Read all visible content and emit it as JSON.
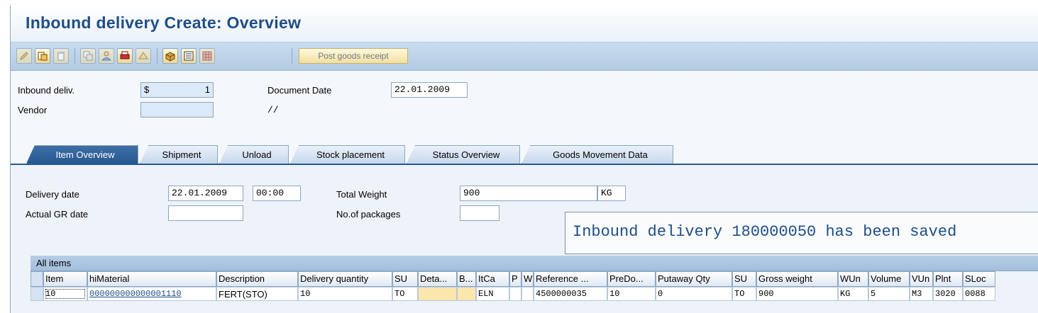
{
  "window": {
    "title": "Inbound delivery  Create: Overview"
  },
  "toolbar": {
    "icons": [
      "edit-pencil-icon",
      "display-change-icon",
      "delete-icon",
      "copy-icon",
      "person-icon",
      "print-icon",
      "ticket-icon",
      "package-icon",
      "structure-icon",
      "grid-icon"
    ],
    "post_goods_receipt_label": "Post goods receipt"
  },
  "header": {
    "inbound_deliv_label": "Inbound deliv.",
    "inbound_deliv_prefix": "$",
    "inbound_deliv_value": "1",
    "document_date_label": "Document Date",
    "document_date_value": "22.01.2009",
    "vendor_label": "Vendor",
    "vendor_value": "",
    "vendor_name": "//"
  },
  "tabs": [
    {
      "label": "Item Overview",
      "active": true
    },
    {
      "label": "Shipment",
      "active": false
    },
    {
      "label": "Unload",
      "active": false
    },
    {
      "label": "Stock placement",
      "active": false
    },
    {
      "label": "Status Overview",
      "active": false
    },
    {
      "label": "Goods Movement Data",
      "active": false
    }
  ],
  "item_overview": {
    "delivery_date_label": "Delivery date",
    "delivery_date_value": "22.01.2009",
    "delivery_time_value": "00:00",
    "actual_gr_date_label": "Actual GR date",
    "actual_gr_date_value": "",
    "total_weight_label": "Total Weight",
    "total_weight_value": "900",
    "total_weight_unit": "KG",
    "no_packages_label": "No.of packages",
    "no_packages_value": ""
  },
  "status_message": "Inbound delivery 180000050 has been saved",
  "items": {
    "title": "All items",
    "columns": [
      "Item",
      "hiMaterial",
      "Description",
      "Delivery quantity",
      "SU",
      "Deta...",
      "B...",
      "ItCa",
      "P",
      "W",
      "Reference ...",
      "PreDo...",
      "Putaway Qty",
      "SU",
      "Gross weight",
      "WUn",
      "Volume",
      "VUn",
      "Plnt",
      "SLoc"
    ],
    "rows": [
      [
        "10",
        "000000000000001110",
        "FERT(STO)",
        "10",
        "TO",
        "",
        "",
        "ELN",
        "",
        "",
        "4500000035",
        "10",
        "0",
        "TO",
        "900",
        "KG",
        "5",
        "M3",
        "3020",
        "0088"
      ]
    ]
  },
  "colors": {
    "title": "#1f4e86",
    "active_tab": "#27588f",
    "toolbar": "#b3cbe3",
    "field_highlight": "#fbe6ae"
  }
}
